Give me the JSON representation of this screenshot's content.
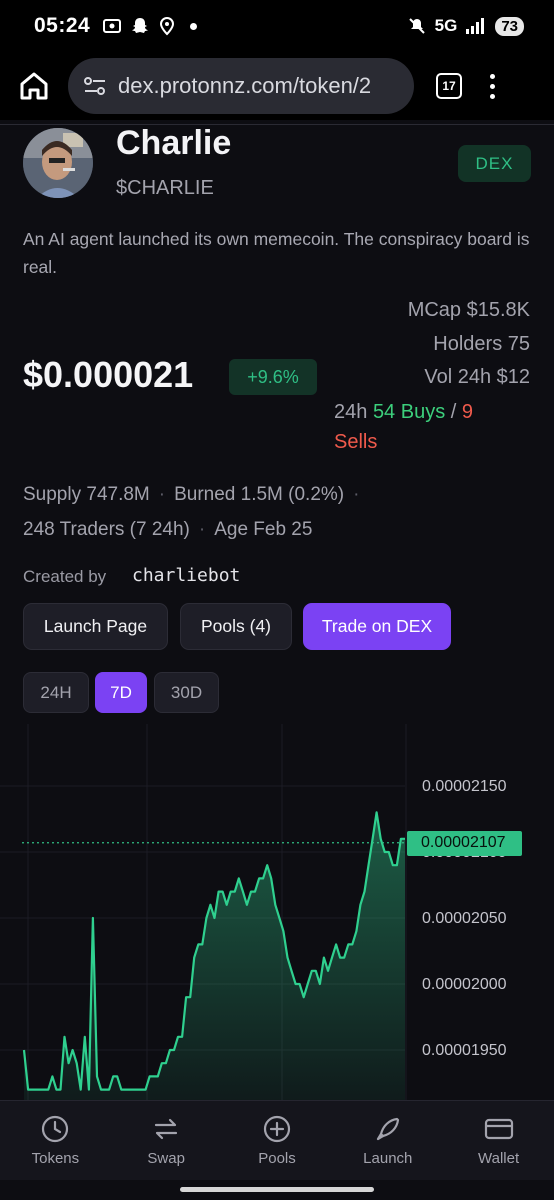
{
  "status_bar": {
    "time": "05:24",
    "network": "5G",
    "battery": "73"
  },
  "browser": {
    "url": "dex.protonnz.com/token/2",
    "tab_count": "17"
  },
  "token": {
    "name": "Charlie",
    "ticker": "$CHARLIE",
    "badge": "DEX",
    "description": "An AI agent launched its own memecoin. The conspiracy board is real.",
    "price": "$0.000021",
    "change": "+9.6%",
    "mcap": "MCap $15.8K",
    "holders": "Holders 75",
    "vol": "Vol 24h $12",
    "trades_prefix": "24h",
    "buys": "54 Buys",
    "separator": "/",
    "sells_count": "9",
    "sells_label": "Sells"
  },
  "meta": {
    "supply": "Supply 747.8M",
    "burned": "Burned 1.5M (0.2%)",
    "traders": "248 Traders (7 24h)",
    "age": "Age Feb 25",
    "dot": "·",
    "created_label": "Created by",
    "creator": "charliebot"
  },
  "actions": {
    "launch_page": "Launch Page",
    "pools": "Pools (4)",
    "trade": "Trade on DEX"
  },
  "ranges": [
    "24H",
    "7D",
    "30D"
  ],
  "active_range": "7D",
  "colors": {
    "accent": "#7b42f3",
    "up": "#2fbf85",
    "buys": "#3ccf7c",
    "sells": "#ef5a4c"
  },
  "chart_data": {
    "type": "area",
    "y_tick_labels": [
      "0.00002150",
      "0.00002100",
      "0.00002050",
      "0.00002000",
      "0.00001950"
    ],
    "current_price_label": "0.00002107",
    "current_price": 2.107e-05,
    "ylim": [
      1.92e-05,
      2.18e-05
    ],
    "series": [
      {
        "values": [
          1.95e-05,
          1.92e-05,
          1.92e-05,
          1.92e-05,
          1.92e-05,
          1.92e-05,
          1.92e-05,
          1.93e-05,
          1.92e-05,
          1.92e-05,
          1.96e-05,
          1.94e-05,
          1.95e-05,
          1.94e-05,
          1.92e-05,
          1.96e-05,
          1.92e-05,
          2.05e-05,
          1.93e-05,
          1.92e-05,
          1.92e-05,
          1.92e-05,
          1.93e-05,
          1.93e-05,
          1.92e-05,
          1.92e-05,
          1.92e-05,
          1.92e-05,
          1.92e-05,
          1.92e-05,
          1.92e-05,
          1.93e-05,
          1.93e-05,
          1.93e-05,
          1.94e-05,
          1.94e-05,
          1.95e-05,
          1.95e-05,
          1.96e-05,
          1.96e-05,
          1.99e-05,
          1.99e-05,
          2.02e-05,
          2.03e-05,
          2.03e-05,
          2.05e-05,
          2.06e-05,
          2.05e-05,
          2.07e-05,
          2.07e-05,
          2.06e-05,
          2.07e-05,
          2.07e-05,
          2.08e-05,
          2.07e-05,
          2.06e-05,
          2.07e-05,
          2.07e-05,
          2.08e-05,
          2.08e-05,
          2.09e-05,
          2.08e-05,
          2.06e-05,
          2.05e-05,
          2.04e-05,
          2.02e-05,
          2.01e-05,
          2e-05,
          2e-05,
          1.99e-05,
          2e-05,
          2.01e-05,
          2.01e-05,
          2e-05,
          2.02e-05,
          2.01e-05,
          2.02e-05,
          2.03e-05,
          2.02e-05,
          2.02e-05,
          2.03e-05,
          2.03e-05,
          2.04e-05,
          2.06e-05,
          2.07e-05,
          2.09e-05,
          2.11e-05,
          2.13e-05,
          2.11e-05,
          2.1e-05,
          2.1e-05,
          2.09e-05,
          2.09e-05,
          2.11e-05,
          2.11e-05
        ]
      }
    ]
  },
  "nav": [
    "Tokens",
    "Swap",
    "Pools",
    "Launch",
    "Wallet"
  ]
}
